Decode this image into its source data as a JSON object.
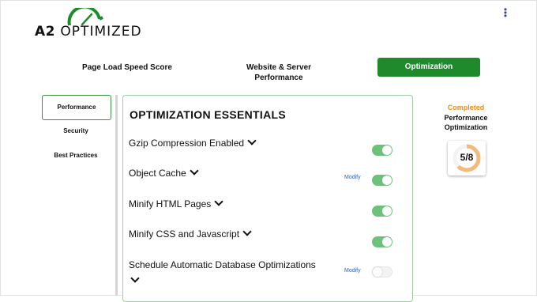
{
  "logo": {
    "brand_a2": "A2",
    "brand_optimized": "OPTIMIZED"
  },
  "menu": {
    "icon": "kebab-menu-icon"
  },
  "tabs": [
    {
      "label": "Page Load Speed Score"
    },
    {
      "label": "Website & Server Performance"
    },
    {
      "label": "Optimization",
      "active": true
    }
  ],
  "nav": [
    {
      "label": "Performance",
      "active": true
    },
    {
      "label": "Security"
    },
    {
      "label": "Best Practices"
    }
  ],
  "panel": {
    "title": "OPTIMIZATION ESSENTIALS",
    "items": [
      {
        "label": "Gzip Compression Enabled",
        "modify": "",
        "enabled": true
      },
      {
        "label": "Object Cache",
        "modify": "Modify",
        "enabled": true
      },
      {
        "label": "Minify HTML Pages",
        "modify": "",
        "enabled": true
      },
      {
        "label": "Minify CSS and Javascript",
        "modify": "",
        "enabled": true
      },
      {
        "label": "Schedule Automatic Database Optimizations",
        "modify": "Modify",
        "enabled": false
      }
    ]
  },
  "score": {
    "status": "Completed",
    "title": "Performance Optimization",
    "display": "5/8",
    "completed": 5,
    "total": 8
  },
  "colors": {
    "accent_green": "#1f8a2c",
    "toggle_on": "#6cc27a",
    "completed_orange": "#f08c1a",
    "link_blue": "#2c5db5",
    "ring_orange": "#f6b97c"
  }
}
